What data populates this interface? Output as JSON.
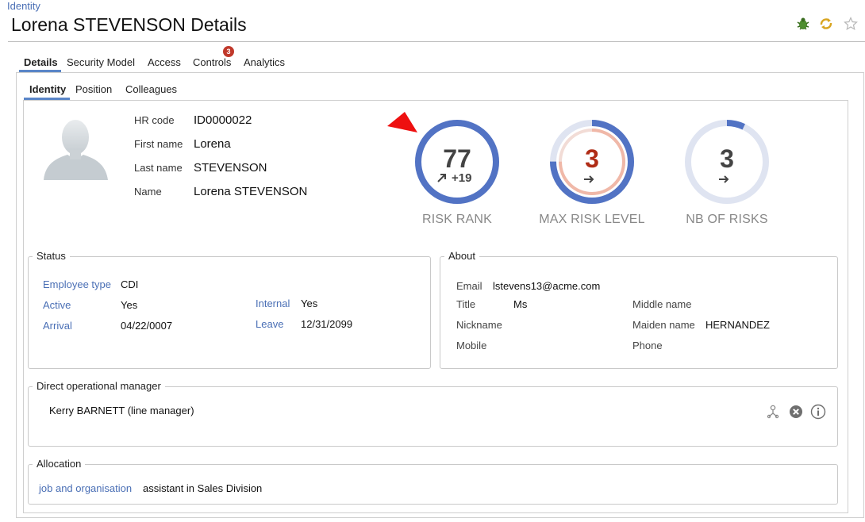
{
  "header": {
    "breadcrumb": "Identity",
    "title": "Lorena STEVENSON Details",
    "icons": [
      "bug-icon",
      "refresh-icon",
      "favorite-star-icon"
    ]
  },
  "tabs": [
    {
      "label": "Details",
      "active": true
    },
    {
      "label": "Security Model"
    },
    {
      "label": "Access"
    },
    {
      "label": "Controls",
      "badge": "3"
    },
    {
      "label": "Analytics"
    }
  ],
  "subtabs": [
    {
      "label": "Identity",
      "active": true
    },
    {
      "label": "Position"
    },
    {
      "label": "Colleagues"
    }
  ],
  "identity": {
    "hr_code_label": "HR code",
    "hr_code": "ID0000022",
    "first_name_label": "First name",
    "first_name": "Lorena",
    "last_name_label": "Last name",
    "last_name": "STEVENSON",
    "name_label": "Name",
    "name": "Lorena STEVENSON"
  },
  "gauges": {
    "risk_rank": {
      "value": "77",
      "delta": "+19",
      "label": "RISK RANK",
      "fill": 1.0
    },
    "max_risk_level": {
      "value": "3",
      "label": "MAX RISK LEVEL",
      "fill": 0.75
    },
    "nb_of_risks": {
      "value": "3",
      "label": "NB OF RISKS",
      "fill": 0.06
    }
  },
  "status": {
    "legend": "Status",
    "employee_type_label": "Employee type",
    "employee_type": "CDI",
    "active_label": "Active",
    "active": "Yes",
    "arrival_label": "Arrival",
    "arrival": "04/22/0007",
    "internal_label": "Internal",
    "internal": "Yes",
    "leave_label": "Leave",
    "leave": "12/31/2099"
  },
  "about": {
    "legend": "About",
    "email_label": "Email",
    "email": "lstevens13@acme.com",
    "title_label": "Title",
    "title": "Ms",
    "nickname_label": "Nickname",
    "mobile_label": "Mobile",
    "middle_name_label": "Middle name",
    "maiden_name_label": "Maiden name",
    "maiden_name": "HERNANDEZ",
    "phone_label": "Phone"
  },
  "manager": {
    "legend": "Direct operational manager",
    "name": "Kerry BARNETT (line manager)"
  },
  "allocation": {
    "legend": "Allocation",
    "label": "job and organisation",
    "value": "assistant in Sales Division"
  },
  "colors": {
    "accent_blue": "#5273c4",
    "ring_light": "#dfe4f1",
    "risk_red": "#b02c16",
    "badge_red": "#c0392b"
  }
}
